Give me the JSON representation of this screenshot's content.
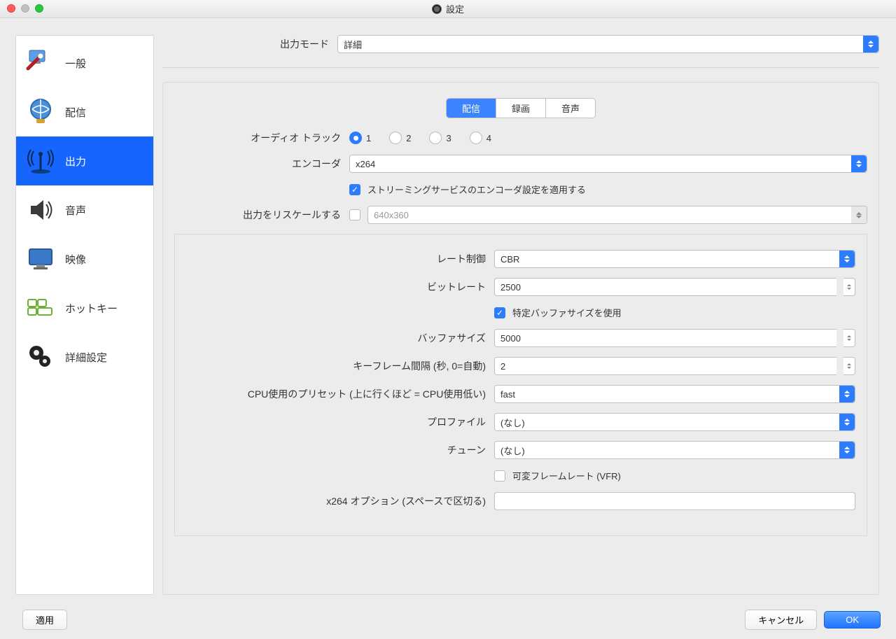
{
  "window": {
    "title": "設定"
  },
  "sidebar": {
    "items": [
      {
        "label": "一般"
      },
      {
        "label": "配信"
      },
      {
        "label": "出力"
      },
      {
        "label": "音声"
      },
      {
        "label": "映像"
      },
      {
        "label": "ホットキー"
      },
      {
        "label": "詳細設定"
      }
    ]
  },
  "output_mode": {
    "label": "出力モード",
    "value": "詳細"
  },
  "tabs": {
    "stream": "配信",
    "record": "録画",
    "audio": "音声"
  },
  "stream": {
    "audio_track_label": "オーディオ トラック",
    "tracks": [
      "1",
      "2",
      "3",
      "4"
    ],
    "encoder_label": "エンコーダ",
    "encoder_value": "x264",
    "enforce_label": "ストリーミングサービスのエンコーダ設定を適用する",
    "rescale_label": "出力をリスケールする",
    "rescale_value": "640x360",
    "rate_control_label": "レート制御",
    "rate_control_value": "CBR",
    "bitrate_label": "ビットレート",
    "bitrate_value": "2500",
    "custom_buffer_label": "特定バッファサイズを使用",
    "buffer_label": "バッファサイズ",
    "buffer_value": "5000",
    "keyframe_label": "キーフレーム間隔 (秒, 0=自動)",
    "keyframe_value": "2",
    "cpu_preset_label": "CPU使用のプリセット (上に行くほど = CPU使用低い)",
    "cpu_preset_value": "fast",
    "profile_label": "プロファイル",
    "profile_value": "(なし)",
    "tune_label": "チューン",
    "tune_value": "(なし)",
    "vfr_label": "可変フレームレート (VFR)",
    "x264_opts_label": "x264 オプション (スペースで区切る)",
    "x264_opts_value": ""
  },
  "footer": {
    "apply": "適用",
    "cancel": "キャンセル",
    "ok": "OK"
  }
}
